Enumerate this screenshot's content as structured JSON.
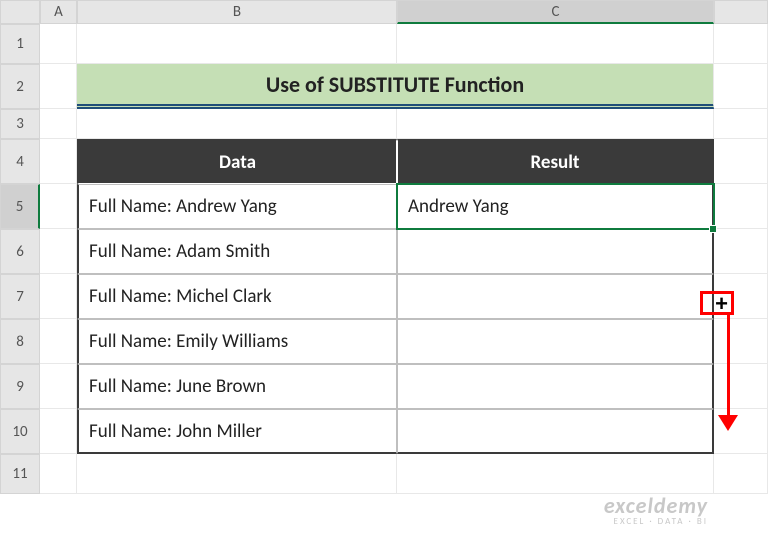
{
  "columns": {
    "blank": "",
    "A": "A",
    "B": "B",
    "C": "C"
  },
  "rows": {
    "r1": "1",
    "r2": "2",
    "r3": "3",
    "r4": "4",
    "r5": "5",
    "r6": "6",
    "r7": "7",
    "r8": "8",
    "r9": "9",
    "r10": "10",
    "r11": "11"
  },
  "title": "Use of SUBSTITUTE Function",
  "headers": {
    "data": "Data",
    "result": "Result"
  },
  "table": [
    {
      "data": "Full Name: Andrew Yang",
      "result": "Andrew Yang"
    },
    {
      "data": "Full Name: Adam Smith",
      "result": ""
    },
    {
      "data": "Full Name: Michel Clark",
      "result": ""
    },
    {
      "data": "Full Name: Emily Williams",
      "result": ""
    },
    {
      "data": "Full Name: June Brown",
      "result": ""
    },
    {
      "data": "Full Name: John Miller",
      "result": ""
    }
  ],
  "watermark": {
    "line1": "exceldemy",
    "line2": "EXCEL · DATA · BI"
  }
}
